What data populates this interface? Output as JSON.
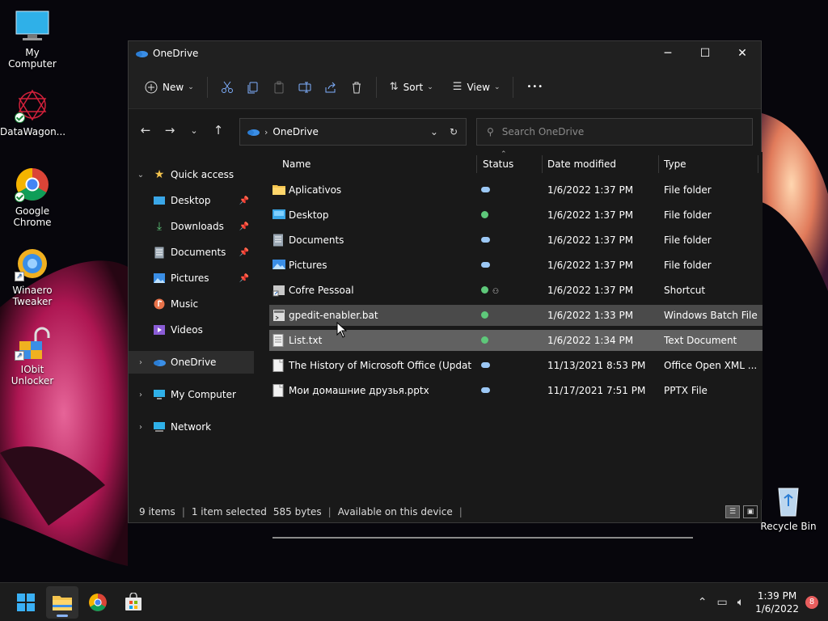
{
  "desktop": {
    "icons": [
      {
        "label": "My Computer"
      },
      {
        "label": "DataWagon..."
      },
      {
        "label": "Google Chrome"
      },
      {
        "label": "Winaero Tweaker"
      },
      {
        "label": "IObit Unlocker"
      },
      {
        "label": "Recycle Bin"
      }
    ]
  },
  "window": {
    "title": "OneDrive",
    "controls": {
      "minimize": "─",
      "maximize": "☐",
      "close": "✕"
    }
  },
  "commandbar": {
    "new_label": "New",
    "sort_label": "Sort",
    "view_label": "View",
    "more_label": "•••"
  },
  "address": {
    "location": "OneDrive",
    "search_placeholder": "Search OneDrive"
  },
  "nav": {
    "quick_access": "Quick access",
    "items": [
      {
        "label": "Desktop",
        "pinned": true
      },
      {
        "label": "Downloads",
        "pinned": true
      },
      {
        "label": "Documents",
        "pinned": true
      },
      {
        "label": "Pictures",
        "pinned": true
      },
      {
        "label": "Music",
        "pinned": false
      },
      {
        "label": "Videos",
        "pinned": false
      }
    ],
    "onedrive": "OneDrive",
    "my_computer": "My Computer",
    "network": "Network"
  },
  "columns": {
    "name": "Name",
    "status": "Status",
    "date": "Date modified",
    "type": "Type"
  },
  "files": [
    {
      "name": "Aplicativos",
      "status": "cloud",
      "date": "1/6/2022 1:37 PM",
      "type": "File folder",
      "icon": "folder"
    },
    {
      "name": "Desktop",
      "status": "ok",
      "date": "1/6/2022 1:37 PM",
      "type": "File folder",
      "icon": "desktop"
    },
    {
      "name": "Documents",
      "status": "cloud",
      "date": "1/6/2022 1:37 PM",
      "type": "File folder",
      "icon": "documents"
    },
    {
      "name": "Pictures",
      "status": "cloud",
      "date": "1/6/2022 1:37 PM",
      "type": "File folder",
      "icon": "pictures"
    },
    {
      "name": "Cofre Pessoal",
      "status": "ok-shared",
      "date": "1/6/2022 1:37 PM",
      "type": "Shortcut",
      "icon": "shortcut"
    },
    {
      "name": "gpedit-enabler.bat",
      "status": "ok",
      "date": "1/6/2022 1:33 PM",
      "type": "Windows Batch File",
      "icon": "bat"
    },
    {
      "name": "List.txt",
      "status": "ok",
      "date": "1/6/2022 1:34 PM",
      "type": "Text Document",
      "icon": "txt"
    },
    {
      "name": "The History of Microsoft Office (Updated...",
      "status": "cloud",
      "date": "11/13/2021 8:53 PM",
      "type": "Office Open XML ...",
      "icon": "doc"
    },
    {
      "name": "Мои домашние друзья.pptx",
      "status": "cloud",
      "date": "11/17/2021 7:51 PM",
      "type": "PPTX File",
      "icon": "doc"
    }
  ],
  "statusbar": {
    "count": "9 items",
    "selected": "1 item selected",
    "size": "585 bytes",
    "availability": "Available on this device"
  },
  "taskbar": {
    "time": "1:39 PM",
    "date": "1/6/2022",
    "notifications": "8"
  },
  "colors": {
    "accent": "#3a8ee6",
    "folder": "#f4c44e",
    "selected_row": "#616161"
  }
}
